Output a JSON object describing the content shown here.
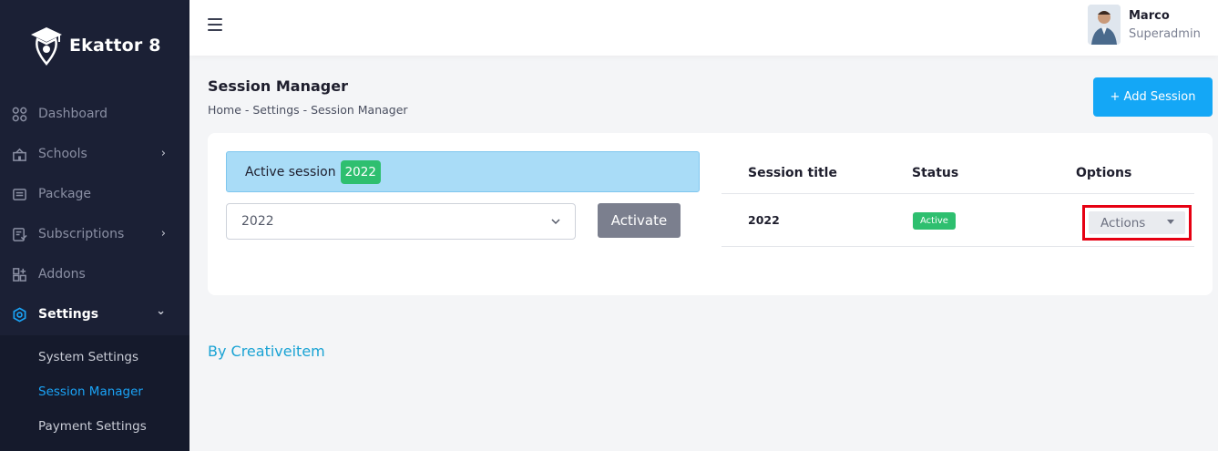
{
  "brand": {
    "name": "Ekattor 8",
    "logo_icon": "graduation-cap-pin-logo"
  },
  "sidebar": {
    "items": [
      {
        "label": "Dashboard",
        "icon": "grid-icon",
        "has_children": false
      },
      {
        "label": "Schools",
        "icon": "school-icon",
        "has_children": true
      },
      {
        "label": "Package",
        "icon": "package-icon",
        "has_children": false
      },
      {
        "label": "Subscriptions",
        "icon": "subscription-icon",
        "has_children": true
      },
      {
        "label": "Addons",
        "icon": "addons-icon",
        "has_children": false
      },
      {
        "label": "Settings",
        "icon": "gear-icon",
        "has_children": true,
        "expanded": true
      }
    ],
    "submenu": [
      {
        "label": "System Settings"
      },
      {
        "label": "Session Manager",
        "active": true
      },
      {
        "label": "Payment Settings"
      }
    ],
    "chevron_right": "›",
    "chevron_down": "⌄"
  },
  "topbar": {
    "user_name": "Marco",
    "user_role": "Superadmin"
  },
  "page": {
    "title": "Session Manager",
    "breadcrumb": "Home - Settings - Session Manager",
    "add_button": "+ Add Session"
  },
  "session_panel": {
    "active_label": "Active session",
    "active_value": "2022",
    "select_value": "2022",
    "activate_button": "Activate"
  },
  "table": {
    "headers": [
      "Session title",
      "Status",
      "Options"
    ],
    "rows": [
      {
        "title": "2022",
        "status": "Active",
        "options": "Actions"
      }
    ]
  },
  "footer": {
    "credit": "By Creativeitem"
  },
  "colors": {
    "sidebar_bg": "#1b2035",
    "accent": "#14a7f6",
    "success": "#2ebf6f",
    "highlight_outline": "#e60012"
  }
}
